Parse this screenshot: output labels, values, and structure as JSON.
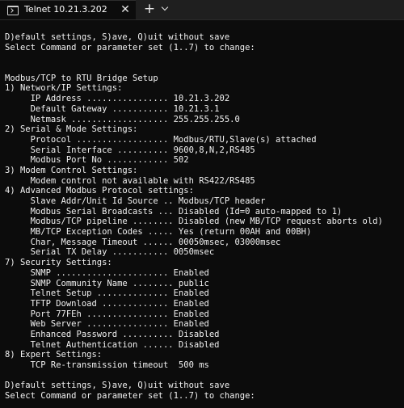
{
  "tab": {
    "icon": "terminal-icon",
    "title": "Telnet 10.21.3.202",
    "close_icon": "close-icon",
    "new_tab_icon": "plus-icon",
    "dropdown_icon": "chevron-down-icon"
  },
  "colors": {
    "terminal_background": "#0c0c0c",
    "terminal_text": "#f2f2f2",
    "tabbar_background": "#1f1f1f"
  },
  "terminal_lines": [
    "D)efault settings, S)ave, Q)uit without save",
    "Select Command or parameter set (1..7) to change:",
    "",
    "",
    "Modbus/TCP to RTU Bridge Setup",
    "1) Network/IP Settings:",
    "     IP Address ................ 10.21.3.202",
    "     Default Gateway ........... 10.21.3.1",
    "     Netmask ................... 255.255.255.0",
    "2) Serial & Mode Settings:",
    "     Protocol .................. Modbus/RTU,Slave(s) attached",
    "     Serial Interface .......... 9600,8,N,2,RS485",
    "     Modbus Port No ............ 502",
    "3) Modem Control Settings:",
    "     Modem control not available with RS422/RS485",
    "4) Advanced Modbus Protocol settings:",
    "     Slave Addr/Unit Id Source .. Modbus/TCP header",
    "     Modbus Serial Broadcasts ... Disabled (Id=0 auto-mapped to 1)",
    "     Modbus/TCP pipeline ........ Disabled (new MB/TCP request aborts old)",
    "     MB/TCP Exception Codes ..... Yes (return 00AH and 00BH)",
    "     Char, Message Timeout ...... 00050msec, 03000msec",
    "     Serial TX Delay ........... 0050msec",
    "7) Security Settings:",
    "     SNMP ...................... Enabled",
    "     SNMP Community Name ........ public",
    "     Telnet Setup .............. Enabled",
    "     TFTP Download ............. Enabled",
    "     Port 77FEh ................ Enabled",
    "     Web Server ................ Enabled",
    "     Enhanced Password .......... Disabled",
    "     Telnet Authentication ...... Disabled",
    "8) Expert Settings:",
    "     TCP Re-transmission timeout  500 ms",
    "",
    "D)efault settings, S)ave, Q)uit without save",
    "Select Command or parameter set (1..7) to change:"
  ]
}
